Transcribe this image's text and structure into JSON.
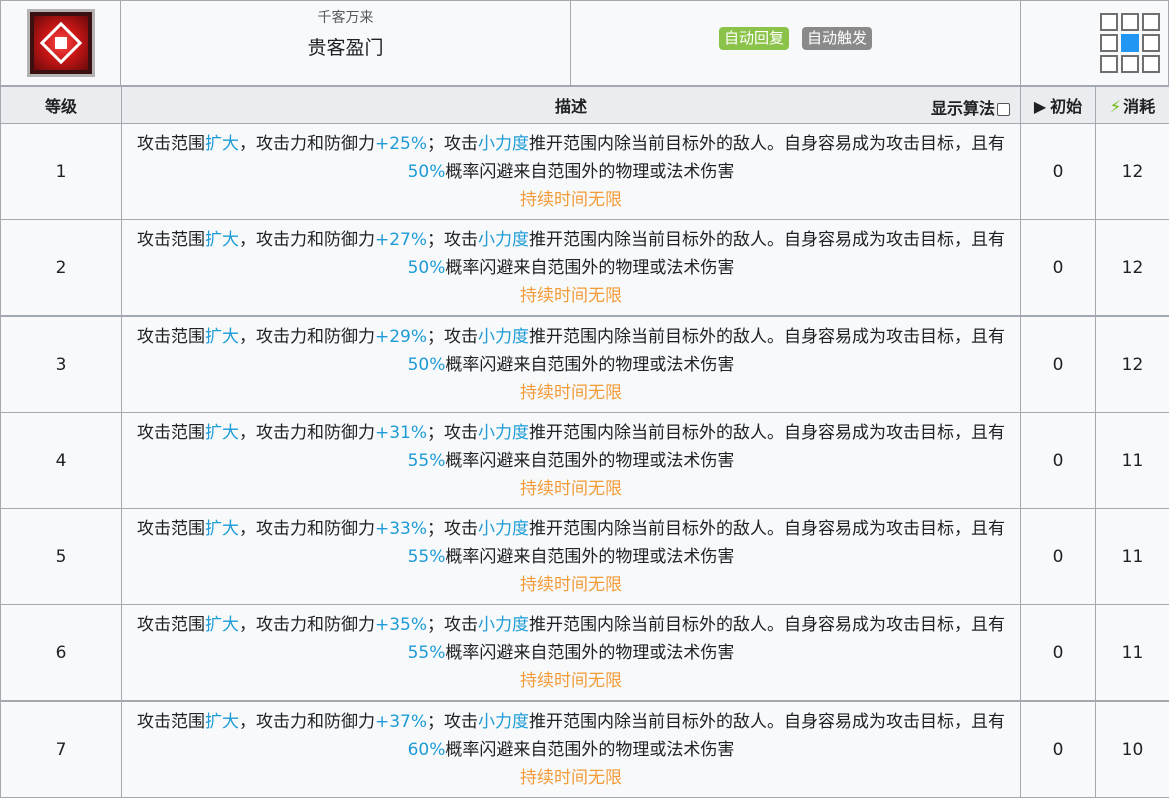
{
  "skill": {
    "subtitle": "千客万来",
    "name": "贵客盈门",
    "tags": [
      "自动回复",
      "自动触发"
    ],
    "icon": "skill-icon",
    "range_grid": [
      0,
      0,
      0,
      0,
      1,
      0,
      0,
      0,
      0
    ]
  },
  "header": {
    "level": "等级",
    "description": "描述",
    "show_algo": "显示算法",
    "initial": "初始",
    "cost": "消耗"
  },
  "desc_parts": {
    "a": "攻击范围",
    "b": "扩大",
    "c": "，攻击力和防御力",
    "d": "；攻击",
    "e": "小力度",
    "f": "推开范围内除当前目标外的敌人。自身容易成为攻击目标，且有",
    "g": "概率闪避来自范围外的物理或法术伤害",
    "duration": "持续时间无限"
  },
  "levels": [
    {
      "level": "1",
      "atk": "+25%",
      "dodge": "50%",
      "initial": "0",
      "cost": "12"
    },
    {
      "level": "2",
      "atk": "+27%",
      "dodge": "50%",
      "initial": "0",
      "cost": "12"
    },
    {
      "level": "3",
      "atk": "+29%",
      "dodge": "50%",
      "initial": "0",
      "cost": "12"
    },
    {
      "level": "4",
      "atk": "+31%",
      "dodge": "55%",
      "initial": "0",
      "cost": "11"
    },
    {
      "level": "5",
      "atk": "+33%",
      "dodge": "55%",
      "initial": "0",
      "cost": "11"
    },
    {
      "level": "6",
      "atk": "+35%",
      "dodge": "55%",
      "initial": "0",
      "cost": "11"
    },
    {
      "level": "7",
      "atk": "+37%",
      "dodge": "60%",
      "initial": "0",
      "cost": "10"
    }
  ],
  "colors": {
    "highlight": "#1d9bd6",
    "duration": "#f29b38",
    "tag_green": "#8bc34a",
    "tag_grey": "#8a8a8a",
    "range_self": "#2196f3"
  }
}
